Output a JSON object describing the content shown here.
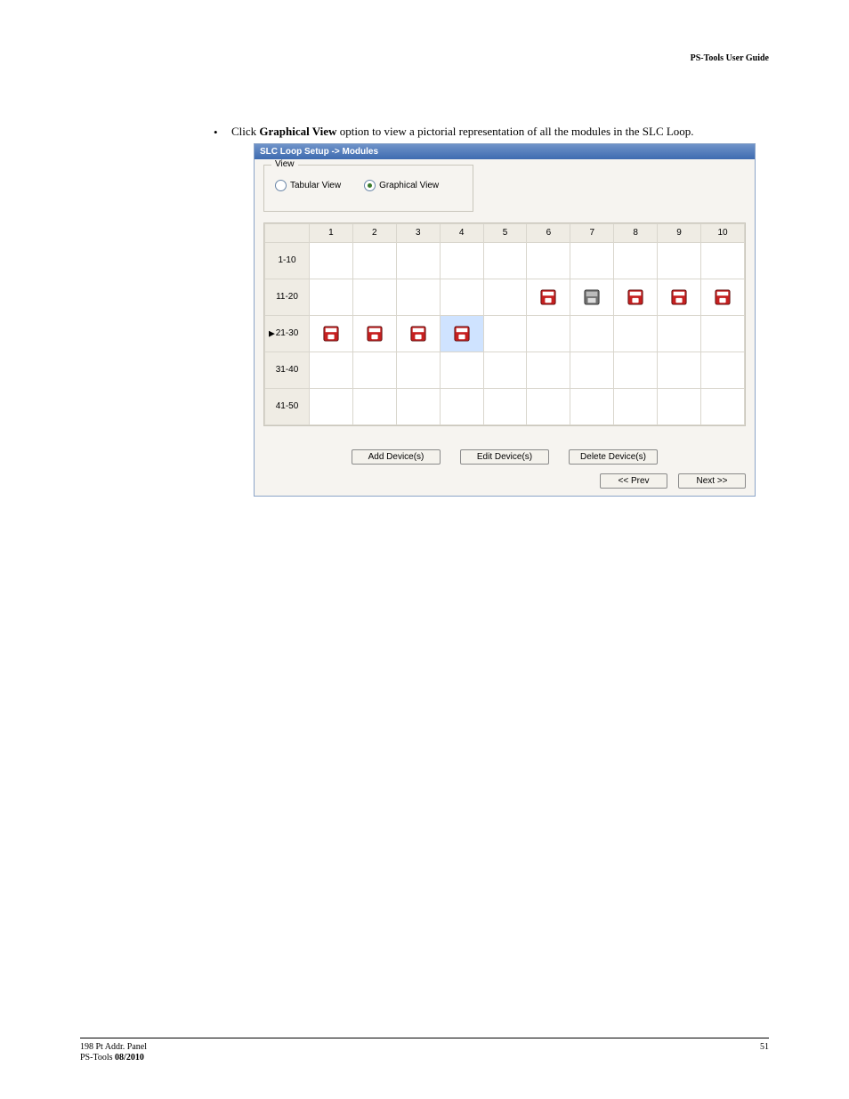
{
  "header": {
    "right": "PS-Tools User Guide"
  },
  "bullet": {
    "pre": "Click ",
    "bold": "Graphical View",
    "post": " option to view a pictorial representation of all the modules in the SLC Loop."
  },
  "screenshot": {
    "title": "SLC Loop Setup -> Modules",
    "view_legend": "View",
    "radios": {
      "tabular": "Tabular View",
      "graphical": "Graphical View"
    },
    "columns": [
      "1",
      "2",
      "3",
      "4",
      "5",
      "6",
      "7",
      "8",
      "9",
      "10"
    ],
    "rows": [
      {
        "label": "1-10",
        "devices": [
          0,
          0,
          0,
          0,
          0,
          0,
          0,
          0,
          0,
          0
        ]
      },
      {
        "label": "11-20",
        "devices": [
          0,
          0,
          0,
          0,
          0,
          1,
          2,
          1,
          1,
          1
        ]
      },
      {
        "label": "21-30",
        "devices": [
          3,
          1,
          1,
          1,
          0,
          0,
          0,
          0,
          0,
          0
        ],
        "active": true,
        "selectedCol": 4
      },
      {
        "label": "31-40",
        "devices": [
          0,
          0,
          0,
          0,
          0,
          0,
          0,
          0,
          0,
          0
        ]
      },
      {
        "label": "41-50",
        "devices": [
          0,
          0,
          0,
          0,
          0,
          0,
          0,
          0,
          0,
          0
        ]
      }
    ],
    "buttons": {
      "add": "Add Device(s)",
      "edit": "Edit Device(s)",
      "delete": "Delete Device(s)"
    },
    "nav": {
      "prev": "<< Prev",
      "next": "Next >>"
    }
  },
  "footer": {
    "line1": "198 Pt Addr. Panel",
    "line2_a": "PS-Tools   ",
    "line2_b": "08/2010",
    "page": "51"
  }
}
